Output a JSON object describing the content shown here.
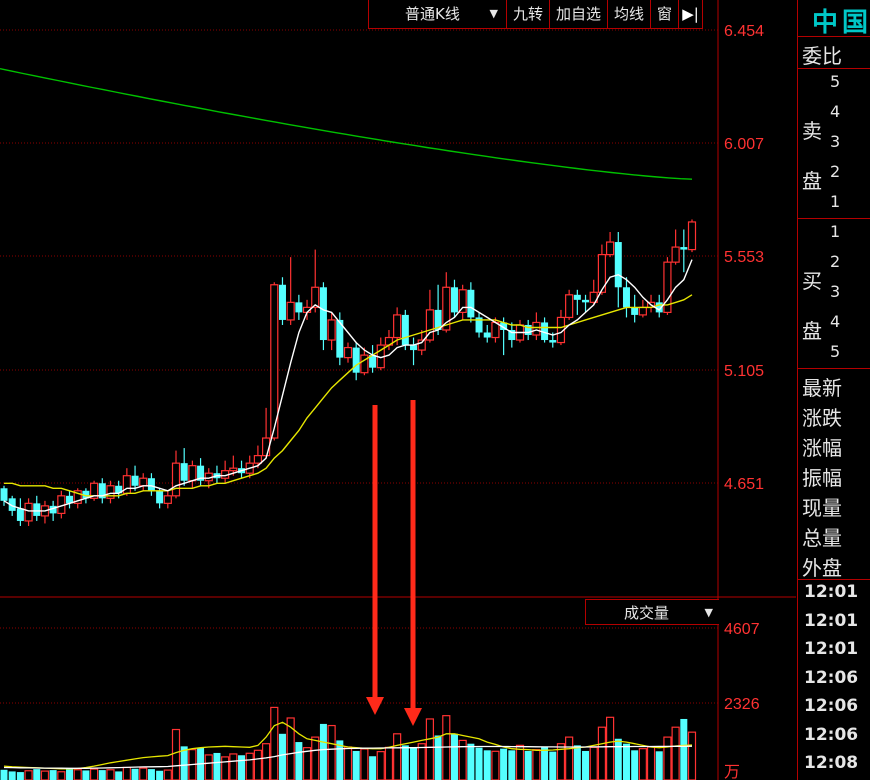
{
  "toolbar": {
    "chart_type": "普通K线",
    "nine_turn": "九转",
    "add_watchlist": "加自选",
    "ma_line": "均线",
    "window": "窗",
    "expand_icon": "panel-expand-icon"
  },
  "stock_name_partial": "中国",
  "price_axis": {
    "ticks": [
      "6.454",
      "6.007",
      "5.553",
      "5.105",
      "4.651"
    ]
  },
  "volume_panel": {
    "selector_label": "成交量",
    "ticks": [
      "4607",
      "2326"
    ],
    "unit": "万"
  },
  "order_book": {
    "ratio_label": "委比",
    "sell_label": "卖盘",
    "sell_levels": [
      "5",
      "4",
      "3",
      "2",
      "1"
    ],
    "buy_label": "买盘",
    "buy_levels": [
      "1",
      "2",
      "3",
      "4",
      "5"
    ],
    "stats": [
      "最新",
      "涨跌",
      "涨幅",
      "振幅",
      "现量",
      "总量",
      "外盘"
    ],
    "tick_times": [
      "12:01",
      "12:01",
      "12:01",
      "12:06",
      "12:06",
      "12:06",
      "12:08"
    ]
  },
  "colors": {
    "up": "#ff3232",
    "down": "#54ffff",
    "ma_white": "#ffffff",
    "ma_yellow": "#e6e600",
    "ma_green": "#00c000",
    "grid": "#8b0000",
    "border": "#b40000",
    "annotation_arrow": "#ff2a1a"
  },
  "chart_data": {
    "type": "candlestick",
    "ylim": [
      4.4,
      6.5
    ],
    "candles": [
      [
        4.63,
        4.58,
        4.64,
        4.56
      ],
      [
        4.59,
        4.54,
        4.6,
        4.52
      ],
      [
        4.55,
        4.5,
        4.59,
        4.48
      ],
      [
        4.5,
        4.57,
        4.59,
        4.48
      ],
      [
        4.57,
        4.52,
        4.6,
        4.5
      ],
      [
        4.52,
        4.56,
        4.58,
        4.49
      ],
      [
        4.56,
        4.53,
        4.58,
        4.5
      ],
      [
        4.53,
        4.6,
        4.62,
        4.51
      ],
      [
        4.6,
        4.57,
        4.62,
        4.55
      ],
      [
        4.57,
        4.62,
        4.63,
        4.55
      ],
      [
        4.62,
        4.59,
        4.63,
        4.57
      ],
      [
        4.59,
        4.65,
        4.66,
        4.58
      ],
      [
        4.65,
        4.59,
        4.67,
        4.57
      ],
      [
        4.59,
        4.64,
        4.66,
        4.57
      ],
      [
        4.64,
        4.61,
        4.66,
        4.59
      ],
      [
        4.61,
        4.68,
        4.71,
        4.6
      ],
      [
        4.68,
        4.64,
        4.72,
        4.62
      ],
      [
        4.64,
        4.67,
        4.69,
        4.62
      ],
      [
        4.67,
        4.62,
        4.69,
        4.6
      ],
      [
        4.62,
        4.57,
        4.63,
        4.55
      ],
      [
        4.57,
        4.6,
        4.62,
        4.55
      ],
      [
        4.6,
        4.73,
        4.78,
        4.59
      ],
      [
        4.73,
        4.66,
        4.79,
        4.64
      ],
      [
        4.66,
        4.72,
        4.74,
        4.63
      ],
      [
        4.72,
        4.66,
        4.75,
        4.64
      ],
      [
        4.66,
        4.69,
        4.71,
        4.63
      ],
      [
        4.69,
        4.67,
        4.72,
        4.65
      ],
      [
        4.67,
        4.7,
        4.74,
        4.65
      ],
      [
        4.7,
        4.71,
        4.76,
        4.68
      ],
      [
        4.71,
        4.69,
        4.74,
        4.67
      ],
      [
        4.69,
        4.73,
        4.76,
        4.67
      ],
      [
        4.73,
        4.76,
        4.8,
        4.71
      ],
      [
        4.76,
        4.83,
        4.95,
        4.75
      ],
      [
        4.83,
        5.44,
        5.45,
        4.82
      ],
      [
        5.44,
        5.3,
        5.47,
        5.28
      ],
      [
        5.3,
        5.37,
        5.55,
        5.28
      ],
      [
        5.37,
        5.33,
        5.4,
        5.3
      ],
      [
        5.33,
        5.35,
        5.38,
        5.3
      ],
      [
        5.35,
        5.43,
        5.58,
        5.33
      ],
      [
        5.43,
        5.22,
        5.45,
        5.18
      ],
      [
        5.22,
        5.3,
        5.33,
        5.18
      ],
      [
        5.3,
        5.15,
        5.33,
        5.12
      ],
      [
        5.15,
        5.19,
        5.21,
        5.13
      ],
      [
        5.19,
        5.09,
        5.21,
        5.06
      ],
      [
        5.09,
        5.16,
        5.19,
        5.08
      ],
      [
        5.16,
        5.11,
        5.2,
        5.09
      ],
      [
        5.11,
        5.2,
        5.23,
        5.1
      ],
      [
        5.2,
        5.23,
        5.26,
        5.18
      ],
      [
        5.23,
        5.32,
        5.35,
        5.2
      ],
      [
        5.32,
        5.2,
        5.34,
        5.18
      ],
      [
        5.2,
        5.18,
        5.23,
        5.12
      ],
      [
        5.18,
        5.22,
        5.26,
        5.16
      ],
      [
        5.22,
        5.34,
        5.42,
        5.21
      ],
      [
        5.34,
        5.26,
        5.44,
        5.24
      ],
      [
        5.26,
        5.43,
        5.49,
        5.25
      ],
      [
        5.43,
        5.33,
        5.46,
        5.31
      ],
      [
        5.33,
        5.42,
        5.44,
        5.3
      ],
      [
        5.42,
        5.31,
        5.45,
        5.29
      ],
      [
        5.31,
        5.25,
        5.33,
        5.23
      ],
      [
        5.25,
        5.23,
        5.28,
        5.21
      ],
      [
        5.23,
        5.29,
        5.31,
        5.21
      ],
      [
        5.29,
        5.26,
        5.31,
        5.16
      ],
      [
        5.26,
        5.22,
        5.29,
        5.19
      ],
      [
        5.22,
        5.28,
        5.3,
        5.21
      ],
      [
        5.28,
        5.24,
        5.3,
        5.22
      ],
      [
        5.24,
        5.29,
        5.33,
        5.22
      ],
      [
        5.29,
        5.22,
        5.31,
        5.21
      ],
      [
        5.22,
        5.21,
        5.25,
        5.19
      ],
      [
        5.21,
        5.31,
        5.34,
        5.2
      ],
      [
        5.31,
        5.4,
        5.42,
        5.3
      ],
      [
        5.4,
        5.38,
        5.42,
        5.32
      ],
      [
        5.38,
        5.37,
        5.4,
        5.33
      ],
      [
        5.37,
        5.41,
        5.46,
        5.36
      ],
      [
        5.41,
        5.56,
        5.6,
        5.4
      ],
      [
        5.56,
        5.61,
        5.65,
        5.55
      ],
      [
        5.61,
        5.43,
        5.65,
        5.35
      ],
      [
        5.43,
        5.35,
        5.47,
        5.31
      ],
      [
        5.35,
        5.32,
        5.4,
        5.29
      ],
      [
        5.32,
        5.35,
        5.38,
        5.31
      ],
      [
        5.35,
        5.37,
        5.4,
        5.33
      ],
      [
        5.37,
        5.33,
        5.4,
        5.31
      ],
      [
        5.33,
        5.53,
        5.55,
        5.32
      ],
      [
        5.53,
        5.59,
        5.66,
        5.52
      ],
      [
        5.59,
        5.58,
        5.66,
        5.49
      ],
      [
        5.58,
        5.69,
        5.7,
        5.57
      ]
    ],
    "ma_white": [
      4.58,
      4.56,
      4.55,
      4.54,
      4.54,
      4.54,
      4.55,
      4.56,
      4.57,
      4.58,
      4.59,
      4.6,
      4.6,
      4.61,
      4.61,
      4.63,
      4.63,
      4.64,
      4.64,
      4.63,
      4.62,
      4.64,
      4.65,
      4.66,
      4.67,
      4.67,
      4.68,
      4.68,
      4.69,
      4.7,
      4.71,
      4.72,
      4.75,
      4.87,
      5.0,
      5.13,
      5.25,
      5.33,
      5.36,
      5.34,
      5.33,
      5.29,
      5.25,
      5.21,
      5.18,
      5.16,
      5.15,
      5.16,
      5.19,
      5.2,
      5.2,
      5.21,
      5.25,
      5.26,
      5.29,
      5.31,
      5.35,
      5.35,
      5.33,
      5.31,
      5.29,
      5.27,
      5.25,
      5.25,
      5.25,
      5.26,
      5.25,
      5.24,
      5.25,
      5.28,
      5.3,
      5.33,
      5.36,
      5.42,
      5.47,
      5.48,
      5.46,
      5.43,
      5.39,
      5.36,
      5.34,
      5.38,
      5.43,
      5.46,
      5.54
    ],
    "ma_yellow": [
      4.65,
      4.65,
      4.64,
      4.64,
      4.64,
      4.64,
      4.63,
      4.63,
      4.62,
      4.61,
      4.6,
      4.6,
      4.6,
      4.6,
      4.6,
      4.61,
      4.61,
      4.62,
      4.62,
      4.62,
      4.62,
      4.63,
      4.63,
      4.63,
      4.64,
      4.64,
      4.65,
      4.65,
      4.66,
      4.67,
      4.68,
      4.69,
      4.71,
      4.75,
      4.78,
      4.82,
      4.86,
      4.91,
      4.95,
      4.99,
      5.03,
      5.06,
      5.09,
      5.12,
      5.14,
      5.16,
      5.18,
      5.2,
      5.22,
      5.23,
      5.24,
      5.25,
      5.26,
      5.27,
      5.28,
      5.29,
      5.3,
      5.3,
      5.3,
      5.3,
      5.3,
      5.29,
      5.28,
      5.28,
      5.27,
      5.27,
      5.27,
      5.27,
      5.27,
      5.28,
      5.29,
      5.3,
      5.31,
      5.32,
      5.33,
      5.34,
      5.35,
      5.35,
      5.35,
      5.35,
      5.36,
      5.36,
      5.37,
      5.38,
      5.4
    ],
    "ma_green_range": [
      6.3,
      5.86
    ],
    "volume": [
      310,
      260,
      240,
      280,
      330,
      270,
      300,
      250,
      340,
      310,
      290,
      330,
      300,
      310,
      260,
      380,
      340,
      360,
      330,
      280,
      300,
      1530,
      1020,
      920,
      980,
      760,
      820,
      700,
      790,
      750,
      810,
      900,
      1100,
      2200,
      1400,
      1880,
      1150,
      980,
      1300,
      1700,
      1650,
      1200,
      1000,
      880,
      940,
      720,
      860,
      990,
      1400,
      1050,
      990,
      1100,
      1850,
      1350,
      1950,
      1400,
      1200,
      1100,
      980,
      900,
      870,
      950,
      900,
      1050,
      880,
      920,
      1000,
      860,
      1100,
      1300,
      1050,
      880,
      990,
      1600,
      1900,
      1250,
      1100,
      900,
      950,
      1000,
      870,
      1300,
      1600,
      1850,
      1450
    ],
    "vol_ma_yellow": [
      420,
      400,
      390,
      380,
      370,
      360,
      350,
      340,
      340,
      350,
      380,
      420,
      470,
      520,
      560,
      600,
      640,
      680,
      700,
      720,
      740,
      830,
      900,
      950,
      980,
      1000,
      1010,
      1020,
      1010,
      1000,
      990,
      1050,
      1300,
      1650,
      1750,
      1600,
      1400,
      1250,
      1200,
      1150,
      1100,
      1050,
      1000,
      980,
      960,
      950,
      950,
      990,
      1050,
      1100,
      1150,
      1200,
      1250,
      1300,
      1400,
      1400,
      1350,
      1300,
      1250,
      1150,
      1080,
      1000,
      950,
      930,
      920,
      900,
      900,
      910,
      930,
      950,
      980,
      1000,
      1050,
      1100,
      1150,
      1180,
      1150,
      1100,
      1050,
      1000,
      980,
      1000,
      1030,
      1050,
      1060
    ],
    "vol_ma_white": [
      380,
      375,
      370,
      368,
      365,
      362,
      360,
      358,
      356,
      355,
      356,
      360,
      365,
      370,
      376,
      383,
      390,
      396,
      400,
      404,
      410,
      430,
      450,
      470,
      490,
      510,
      530,
      550,
      570,
      590,
      610,
      640,
      670,
      710,
      760,
      800,
      840,
      870,
      900,
      920,
      935,
      945,
      955,
      960,
      965,
      968,
      970,
      972,
      975,
      978,
      980,
      985,
      990,
      995,
      1000,
      1005,
      1010,
      1012,
      1014,
      1015,
      1015,
      1014,
      1012,
      1010,
      1008,
      1006,
      1004,
      1002,
      1000,
      1000,
      1000,
      1000,
      1002,
      1005,
      1008,
      1010,
      1012,
      1014,
      1015,
      1016,
      1017,
      1018,
      1020,
      1022,
      1024
    ],
    "vol_ylim": [
      0,
      5500
    ]
  }
}
